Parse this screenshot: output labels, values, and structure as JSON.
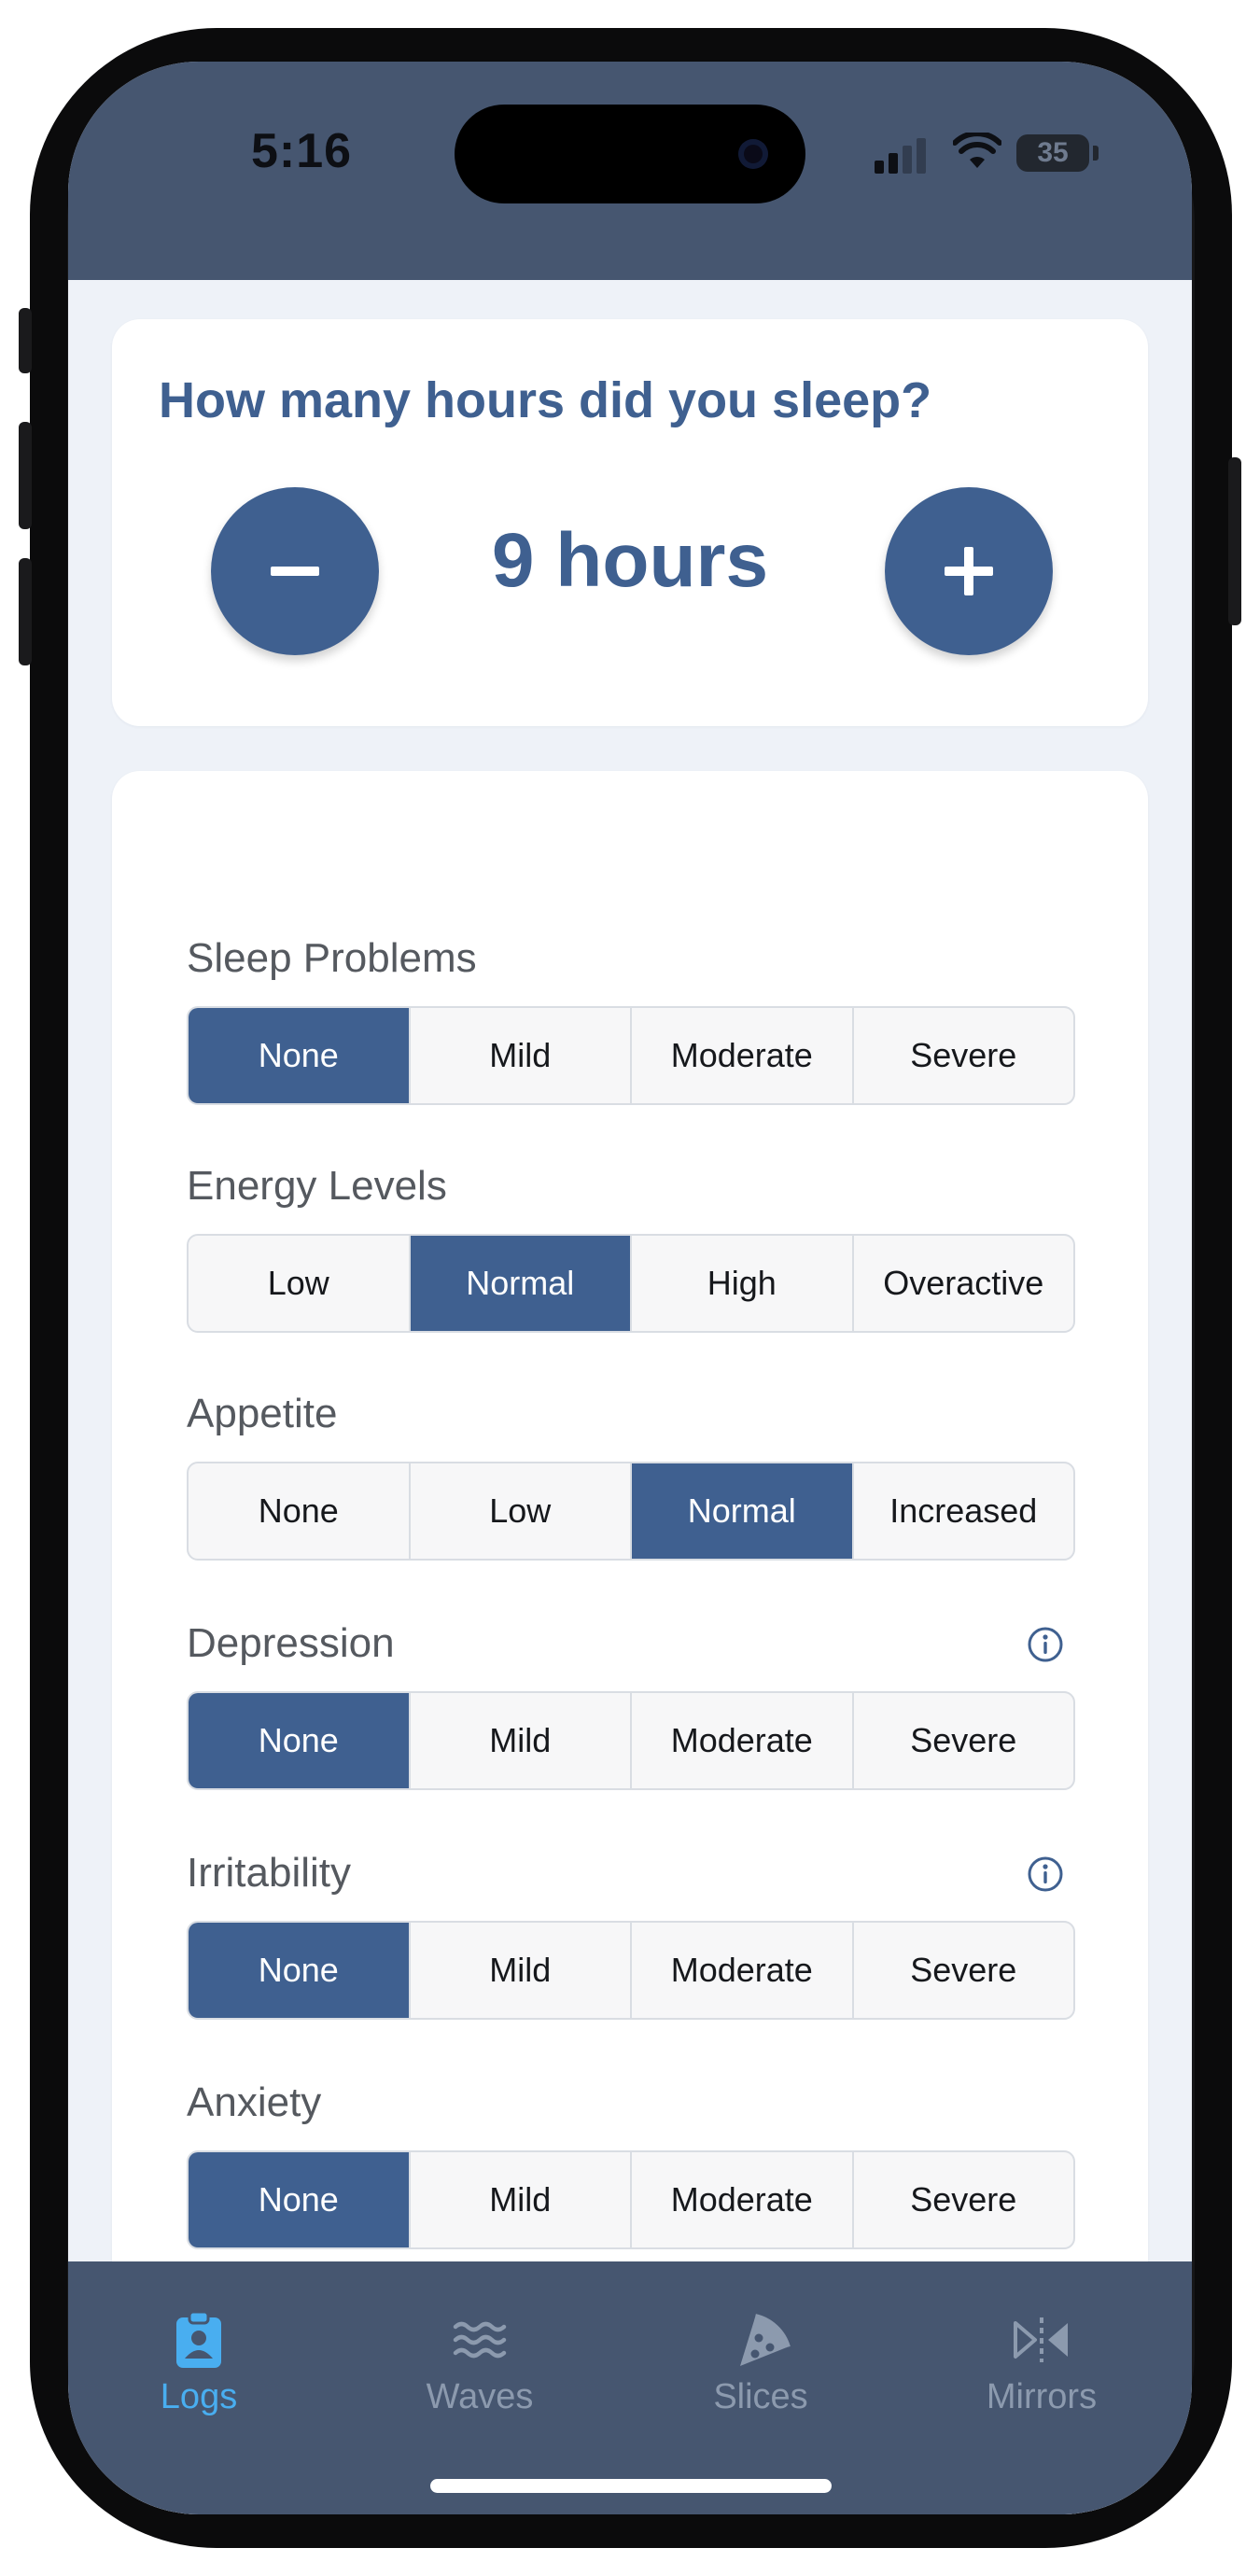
{
  "status_bar": {
    "time": "5:16",
    "battery": "35",
    "icons": [
      "cellular-signal-icon",
      "wifi-icon",
      "battery-icon"
    ]
  },
  "sleep": {
    "question": "How many hours did you sleep?",
    "hours_display": "9 hours",
    "minus_icon": "minus-icon",
    "plus_icon": "plus-icon"
  },
  "symptom_groups": [
    {
      "label": "Sleep Problems",
      "options": [
        "None",
        "Mild",
        "Moderate",
        "Severe"
      ],
      "selected": 0,
      "info": false
    },
    {
      "label": "Energy Levels",
      "options": [
        "Low",
        "Normal",
        "High",
        "Overactive"
      ],
      "selected": 1,
      "info": false
    },
    {
      "label": "Appetite",
      "options": [
        "None",
        "Low",
        "Normal",
        "Increased"
      ],
      "selected": 2,
      "info": false
    },
    {
      "label": "Depression",
      "options": [
        "None",
        "Mild",
        "Moderate",
        "Severe"
      ],
      "selected": 0,
      "info": true
    },
    {
      "label": "Irritability",
      "options": [
        "None",
        "Mild",
        "Moderate",
        "Severe"
      ],
      "selected": 0,
      "info": true
    },
    {
      "label": "Anxiety",
      "options": [
        "None",
        "Mild",
        "Moderate",
        "Severe"
      ],
      "selected": 0,
      "info": false
    }
  ],
  "tab_bar": {
    "tabs": [
      {
        "label": "Logs",
        "icon": "clipboard-user-icon",
        "active": true
      },
      {
        "label": "Waves",
        "icon": "waves-icon",
        "active": false
      },
      {
        "label": "Slices",
        "icon": "pizza-slice-icon",
        "active": false
      },
      {
        "label": "Mirrors",
        "icon": "mirror-icon",
        "active": false
      }
    ]
  },
  "colors": {
    "primary": "#3f6090",
    "header": "#465670",
    "tab_active": "#49aef0",
    "tab_inactive": "#8c9aae",
    "background": "#eef2f8"
  }
}
